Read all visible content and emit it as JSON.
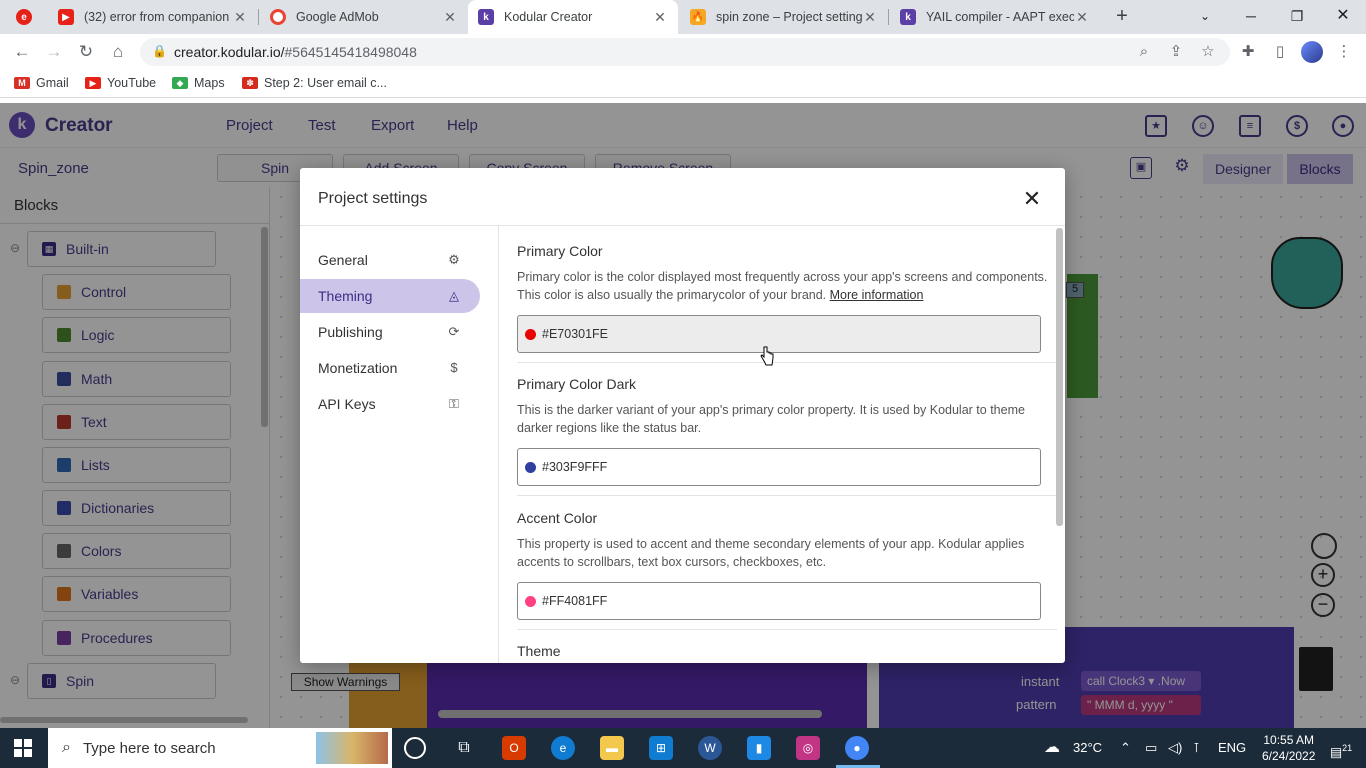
{
  "browser": {
    "tabs": [
      {
        "title": "(32) error from companion",
        "favicon_color": "#e62117",
        "icon": "youtube-icon"
      },
      {
        "title": "Google AdMob",
        "favicon_color": "#ea4335",
        "icon": "admob-icon"
      },
      {
        "title": "Kodular Creator",
        "favicon_color": "#5b3fa6",
        "icon": "kodular-icon"
      },
      {
        "title": "spin zone – Project settings",
        "favicon_color": "#f5a623",
        "icon": "firebase-icon"
      },
      {
        "title": "YAIL compiler - AAPT execu",
        "favicon_color": "#5b3fa6",
        "icon": "kodular-icon"
      }
    ],
    "url_host": "creator.kodular.io/",
    "url_path": "#5645145418498048",
    "bookmarks": [
      "Gmail",
      "YouTube",
      "Maps",
      "Step 2: User email c..."
    ]
  },
  "app": {
    "logo_text": "Creator",
    "menu": [
      "Project",
      "Test",
      "Export",
      "Help"
    ],
    "project_name": "Spin_zone",
    "screen_selector": "Spin",
    "subbar_buttons": [
      "Add Screen",
      "Copy Screen",
      "Remove Screen"
    ],
    "designer_label": "Designer",
    "blocks_label": "Blocks",
    "blocks_panel_title": "Blocks",
    "builtin_label": "Built-in",
    "categories": [
      {
        "label": "Control",
        "color": "#e5a031"
      },
      {
        "label": "Logic",
        "color": "#4c8c2b"
      },
      {
        "label": "Math",
        "color": "#3d4ea0"
      },
      {
        "label": "Text",
        "color": "#b83a2e"
      },
      {
        "label": "Lists",
        "color": "#2d6ab7"
      },
      {
        "label": "Dictionaries",
        "color": "#3a4bb0"
      },
      {
        "label": "Colors",
        "color": "#666666"
      },
      {
        "label": "Variables",
        "color": "#e07820"
      },
      {
        "label": "Procedures",
        "color": "#7a3fa0"
      }
    ],
    "spin_label": "Spin",
    "show_warnings": "Show Warnings"
  },
  "modal": {
    "title": "Project settings",
    "nav": [
      "General",
      "Theming",
      "Publishing",
      "Monetization",
      "API Keys"
    ],
    "active_nav": "Theming",
    "sections": [
      {
        "title": "Primary Color",
        "desc": "Primary color is the color displayed most frequently across your app's screens and components. This color is also usually the primarycolor of your brand.",
        "link": "More information",
        "value": "#E70301FE",
        "swatch": "#e70301"
      },
      {
        "title": "Primary Color Dark",
        "desc": "This is the darker variant of your app's primary color property. It is used by Kodular to theme darker regions like the status bar.",
        "value": "#303F9FFF",
        "swatch": "#303f9f"
      },
      {
        "title": "Accent Color",
        "desc": "This property is used to accent and theme secondary elements of your app. Kodular applies accents to scrollbars, text box cursors, checkboxes, etc.",
        "value": "#FF4081FF",
        "swatch": "#ff4081"
      },
      {
        "title": "Theme"
      }
    ]
  },
  "taskbar": {
    "search_placeholder": "Type here to search",
    "temperature": "32°C",
    "language": "ENG",
    "time": "10:55 AM",
    "date": "6/24/2022",
    "notifications": "21"
  }
}
